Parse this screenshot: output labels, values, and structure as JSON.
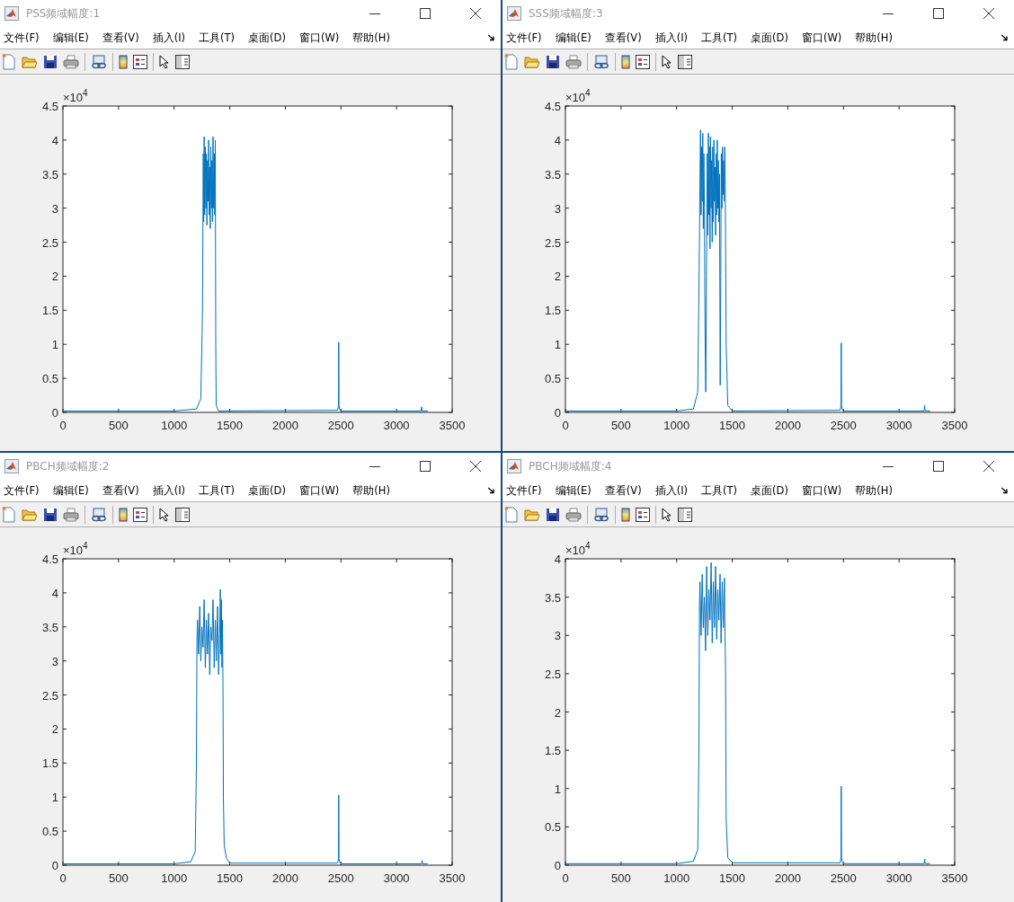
{
  "windows": [
    {
      "title": "PSS频域幅度:1",
      "menu": [
        "文件(F)",
        "编辑(E)",
        "查看(V)",
        "插入(I)",
        "工具(T)",
        "桌面(D)",
        "窗口(W)",
        "帮助(H)"
      ],
      "axis_multiplier": {
        "base": "×10",
        "exponent": "4"
      },
      "chart_data": {
        "type": "line",
        "xlim": [
          0,
          3500
        ],
        "ylim": [
          0,
          4.5
        ],
        "xticks": [
          0,
          500,
          1000,
          1500,
          2000,
          2500,
          3000,
          3500
        ],
        "yticks": [
          0,
          0.5,
          1,
          1.5,
          2,
          2.5,
          3,
          3.5,
          4,
          4.5
        ],
        "x": [
          0,
          1000,
          1200,
          1240,
          1255,
          1262,
          1266,
          1270,
          1275,
          1280,
          1285,
          1290,
          1295,
          1300,
          1305,
          1310,
          1315,
          1320,
          1325,
          1330,
          1335,
          1340,
          1345,
          1350,
          1355,
          1360,
          1365,
          1370,
          1374,
          1378,
          1400,
          2470,
          2478,
          2480,
          2482,
          2490,
          2500,
          3220,
          3225,
          3230,
          3280
        ],
        "series": [
          {
            "color": "#0072bd",
            "values": [
              0.02,
              0.02,
              0.05,
              0.2,
              1.5,
              3.8,
              2.8,
              4.05,
              2.9,
              3.9,
              3.0,
              3.8,
              2.75,
              3.7,
              3.1,
              4.0,
              2.9,
              3.6,
              2.7,
              3.9,
              3.0,
              3.7,
              2.8,
              4.05,
              3.0,
              3.8,
              2.9,
              4.0,
              1.0,
              0.1,
              0.02,
              0.03,
              0.1,
              1.03,
              0.1,
              0.04,
              0.02,
              0.02,
              0.08,
              0.02,
              0.02
            ]
          }
        ]
      }
    },
    {
      "title": "SSS频域幅度:3",
      "menu": [
        "文件(F)",
        "编辑(E)",
        "查看(V)",
        "插入(I)",
        "工具(T)",
        "桌面(D)",
        "窗口(W)",
        "帮助(H)"
      ],
      "axis_multiplier": {
        "base": "×10",
        "exponent": "4"
      },
      "chart_data": {
        "type": "line",
        "xlim": [
          0,
          3500
        ],
        "ylim": [
          0,
          4.5
        ],
        "xticks": [
          0,
          500,
          1000,
          1500,
          2000,
          2500,
          3000,
          3500
        ],
        "yticks": [
          0,
          0.5,
          1,
          1.5,
          2,
          2.5,
          3,
          3.5,
          4,
          4.5
        ],
        "x": [
          0,
          1000,
          1150,
          1190,
          1205,
          1210,
          1215,
          1220,
          1225,
          1230,
          1235,
          1240,
          1245,
          1250,
          1255,
          1262,
          1268,
          1275,
          1280,
          1285,
          1290,
          1295,
          1300,
          1305,
          1310,
          1315,
          1320,
          1325,
          1330,
          1335,
          1340,
          1345,
          1350,
          1355,
          1360,
          1365,
          1370,
          1375,
          1380,
          1385,
          1392,
          1397,
          1402,
          1407,
          1412,
          1417,
          1422,
          1427,
          1432,
          1437,
          1445,
          1460,
          1500,
          2470,
          2478,
          2480,
          2482,
          2490,
          2500,
          3225,
          3230,
          3235,
          3280
        ],
        "series": [
          {
            "color": "#0072bd",
            "values": [
              0.02,
              0.02,
              0.05,
              0.3,
              2.5,
              3.5,
              4.15,
              2.9,
              3.9,
              3.1,
              4.1,
              2.7,
              3.8,
              3.0,
              1.2,
              0.3,
              2.0,
              3.8,
              2.6,
              4.1,
              2.9,
              3.9,
              2.4,
              4.05,
              3.0,
              3.7,
              2.5,
              3.9,
              2.8,
              4.0,
              3.1,
              3.6,
              2.6,
              3.8,
              2.9,
              4.0,
              3.0,
              3.7,
              2.8,
              3.5,
              0.4,
              2.0,
              3.8,
              3.0,
              3.9,
              3.2,
              3.7,
              3.1,
              3.9,
              3.3,
              1.0,
              0.1,
              0.02,
              0.03,
              0.1,
              1.02,
              0.1,
              0.04,
              0.02,
              0.02,
              0.1,
              0.02,
              0.02
            ]
          }
        ]
      }
    },
    {
      "title": "PBCH频域幅度:2",
      "menu": [
        "文件(F)",
        "编辑(E)",
        "查看(V)",
        "插入(I)",
        "工具(T)",
        "桌面(D)",
        "窗口(W)",
        "帮助(H)"
      ],
      "axis_multiplier": {
        "base": "×10",
        "exponent": "4"
      },
      "chart_data": {
        "type": "line",
        "xlim": [
          0,
          3500
        ],
        "ylim": [
          0,
          4.5
        ],
        "xticks": [
          0,
          500,
          1000,
          1500,
          2000,
          2500,
          3000,
          3500
        ],
        "yticks": [
          0,
          0.5,
          1,
          1.5,
          2,
          2.5,
          3,
          3.5,
          4,
          4.5
        ],
        "x": [
          0,
          1000,
          1150,
          1190,
          1200,
          1205,
          1210,
          1220,
          1230,
          1240,
          1250,
          1260,
          1270,
          1280,
          1290,
          1300,
          1310,
          1320,
          1330,
          1340,
          1350,
          1360,
          1370,
          1380,
          1390,
          1400,
          1410,
          1415,
          1420,
          1425,
          1430,
          1435,
          1440,
          1443,
          1450,
          1470,
          1500,
          2470,
          2478,
          2480,
          2482,
          2490,
          2500,
          3225,
          3230,
          3235,
          3280
        ],
        "series": [
          {
            "color": "#0072bd",
            "values": [
              0.02,
              0.02,
              0.05,
              0.2,
              1.5,
              3.3,
              3.6,
              3.1,
              3.8,
              3.0,
              3.5,
              3.2,
              3.9,
              2.9,
              3.6,
              3.1,
              3.7,
              2.8,
              3.5,
              3.3,
              3.9,
              2.9,
              3.6,
              3.0,
              3.8,
              2.8,
              3.4,
              4.05,
              3.1,
              3.9,
              2.9,
              3.6,
              2.5,
              1.0,
              0.3,
              0.1,
              0.03,
              0.03,
              0.1,
              1.03,
              0.1,
              0.04,
              0.02,
              0.02,
              0.07,
              0.02,
              0.02
            ]
          }
        ]
      }
    },
    {
      "title": "PBCH频域幅度:4",
      "menu": [
        "文件(F)",
        "编辑(E)",
        "查看(V)",
        "插入(I)",
        "工具(T)",
        "桌面(D)",
        "窗口(W)",
        "帮助(H)"
      ],
      "axis_multiplier": {
        "base": "×10",
        "exponent": "4"
      },
      "chart_data": {
        "type": "line",
        "xlim": [
          0,
          3500
        ],
        "ylim": [
          0,
          4
        ],
        "xticks": [
          0,
          500,
          1000,
          1500,
          2000,
          2500,
          3000,
          3500
        ],
        "yticks": [
          0,
          0.5,
          1,
          1.5,
          2,
          2.5,
          3,
          3.5,
          4
        ],
        "x": [
          0,
          1000,
          1150,
          1190,
          1200,
          1205,
          1210,
          1220,
          1230,
          1240,
          1250,
          1260,
          1270,
          1280,
          1290,
          1300,
          1310,
          1320,
          1330,
          1340,
          1350,
          1360,
          1370,
          1380,
          1390,
          1400,
          1410,
          1420,
          1430,
          1435,
          1440,
          1445,
          1460,
          1500,
          2470,
          2478,
          2480,
          2482,
          2490,
          2500,
          3225,
          3230,
          3235,
          3280
        ],
        "series": [
          {
            "color": "#0072bd",
            "values": [
              0.02,
              0.02,
              0.05,
              0.2,
              1.5,
              3.4,
              3.7,
              3.0,
              3.8,
              3.1,
              3.5,
              2.8,
              3.9,
              3.0,
              3.6,
              3.2,
              3.95,
              2.9,
              3.7,
              3.1,
              3.9,
              2.95,
              3.6,
              3.2,
              3.8,
              2.9,
              3.7,
              3.1,
              3.75,
              3.0,
              2.6,
              0.6,
              0.1,
              0.03,
              0.03,
              0.1,
              1.03,
              0.1,
              0.04,
              0.02,
              0.02,
              0.08,
              0.02,
              0.02
            ]
          }
        ]
      }
    }
  ]
}
